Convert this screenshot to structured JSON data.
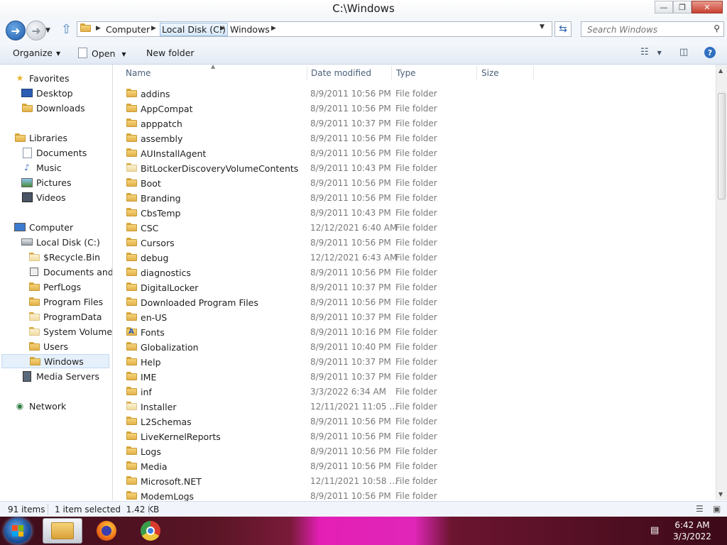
{
  "window": {
    "title": "C:\\Windows",
    "minimize": "—",
    "maximize": "❐",
    "close": "✕"
  },
  "address": {
    "crumbs": [
      "Computer",
      "Local Disk (C:)",
      "Windows"
    ],
    "search_placeholder": "Search Windows"
  },
  "toolbar": {
    "organize": "Organize",
    "open": "Open",
    "new_folder": "New folder"
  },
  "nav": {
    "favorites": "Favorites",
    "desktop": "Desktop",
    "downloads": "Downloads",
    "libraries": "Libraries",
    "documents": "Documents",
    "music": "Music",
    "pictures": "Pictures",
    "videos": "Videos",
    "computer": "Computer",
    "local_disk": "Local Disk (C:)",
    "recycle": "$Recycle.Bin",
    "docs_settings": "Documents and Se",
    "perflogs": "PerfLogs",
    "program_files": "Program Files",
    "programdata": "ProgramData",
    "system_volume": "System Volume In",
    "users": "Users",
    "windows": "Windows",
    "media_servers": "Media Servers",
    "network": "Network"
  },
  "columns": {
    "name": "Name",
    "date": "Date modified",
    "type": "Type",
    "size": "Size"
  },
  "files": [
    {
      "name": "addins",
      "date": "8/9/2011 10:56 PM",
      "type": "File folder"
    },
    {
      "name": "AppCompat",
      "date": "8/9/2011 10:56 PM",
      "type": "File folder"
    },
    {
      "name": "apppatch",
      "date": "8/9/2011 10:37 PM",
      "type": "File folder"
    },
    {
      "name": "assembly",
      "date": "8/9/2011 10:56 PM",
      "type": "File folder"
    },
    {
      "name": "AUInstallAgent",
      "date": "8/9/2011 10:56 PM",
      "type": "File folder"
    },
    {
      "name": "BitLockerDiscoveryVolumeContents",
      "date": "8/9/2011 10:43 PM",
      "type": "File folder"
    },
    {
      "name": "Boot",
      "date": "8/9/2011 10:56 PM",
      "type": "File folder"
    },
    {
      "name": "Branding",
      "date": "8/9/2011 10:56 PM",
      "type": "File folder"
    },
    {
      "name": "CbsTemp",
      "date": "8/9/2011 10:43 PM",
      "type": "File folder"
    },
    {
      "name": "CSC",
      "date": "12/12/2021 6:40 AM",
      "type": "File folder"
    },
    {
      "name": "Cursors",
      "date": "8/9/2011 10:56 PM",
      "type": "File folder"
    },
    {
      "name": "debug",
      "date": "12/12/2021 6:43 AM",
      "type": "File folder"
    },
    {
      "name": "diagnostics",
      "date": "8/9/2011 10:56 PM",
      "type": "File folder"
    },
    {
      "name": "DigitalLocker",
      "date": "8/9/2011 10:37 PM",
      "type": "File folder"
    },
    {
      "name": "Downloaded Program Files",
      "date": "8/9/2011 10:56 PM",
      "type": "File folder"
    },
    {
      "name": "en-US",
      "date": "8/9/2011 10:37 PM",
      "type": "File folder"
    },
    {
      "name": "Fonts",
      "date": "8/9/2011 10:16 PM",
      "type": "File folder"
    },
    {
      "name": "Globalization",
      "date": "8/9/2011 10:40 PM",
      "type": "File folder"
    },
    {
      "name": "Help",
      "date": "8/9/2011 10:37 PM",
      "type": "File folder"
    },
    {
      "name": "IME",
      "date": "8/9/2011 10:37 PM",
      "type": "File folder"
    },
    {
      "name": "inf",
      "date": "3/3/2022 6:34 AM",
      "type": "File folder"
    },
    {
      "name": "Installer",
      "date": "12/11/2021 11:05 ...",
      "type": "File folder"
    },
    {
      "name": "L2Schemas",
      "date": "8/9/2011 10:56 PM",
      "type": "File folder"
    },
    {
      "name": "LiveKernelReports",
      "date": "8/9/2011 10:56 PM",
      "type": "File folder"
    },
    {
      "name": "Logs",
      "date": "8/9/2011 10:56 PM",
      "type": "File folder"
    },
    {
      "name": "Media",
      "date": "8/9/2011 10:56 PM",
      "type": "File folder"
    },
    {
      "name": "Microsoft.NET",
      "date": "12/11/2021 10:58 ...",
      "type": "File folder"
    },
    {
      "name": "ModemLogs",
      "date": "8/9/2011 10:56 PM",
      "type": "File folder"
    }
  ],
  "status": {
    "count": "91 items",
    "selected": "1 item selected  1.42 KB"
  },
  "taskbar": {
    "time": "6:42 AM",
    "date": "3/3/2022"
  }
}
